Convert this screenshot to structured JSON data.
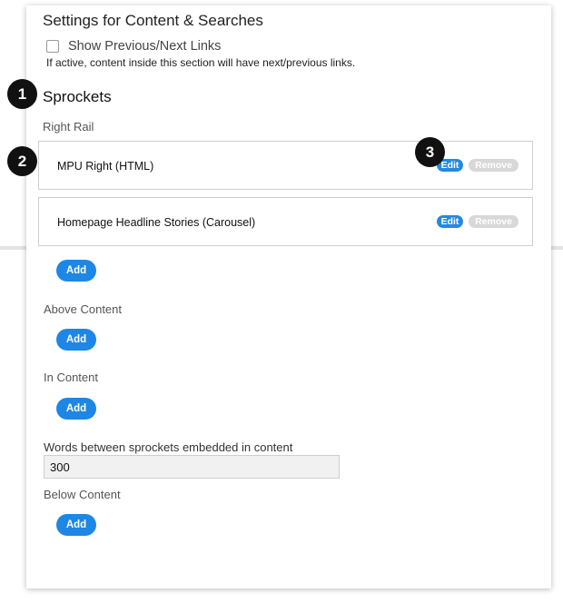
{
  "settings": {
    "title": "Settings for Content & Searches",
    "checkbox_label": "Show Previous/Next Links",
    "help_text": "If active, content inside this section will have next/previous links."
  },
  "sprockets": {
    "title": "Sprockets",
    "right_rail": {
      "label": "Right Rail",
      "items": [
        {
          "title": "MPU Right (HTML)",
          "edit": "Edit",
          "remove": "Remove"
        },
        {
          "title": "Homepage Headline Stories (Carousel)",
          "edit": "Edit",
          "remove": "Remove"
        }
      ],
      "add": "Add"
    },
    "above_content": {
      "label": "Above Content",
      "add": "Add"
    },
    "in_content": {
      "label": "In Content",
      "add": "Add"
    },
    "words_between": {
      "label": "Words between sprockets embedded in content",
      "value": "300"
    },
    "below_content": {
      "label": "Below Content",
      "add": "Add"
    }
  },
  "markers": [
    "1",
    "2",
    "3"
  ],
  "colors": {
    "accent": "#1e87e5",
    "disabled": "#d8d8d8",
    "marker": "#111111"
  }
}
